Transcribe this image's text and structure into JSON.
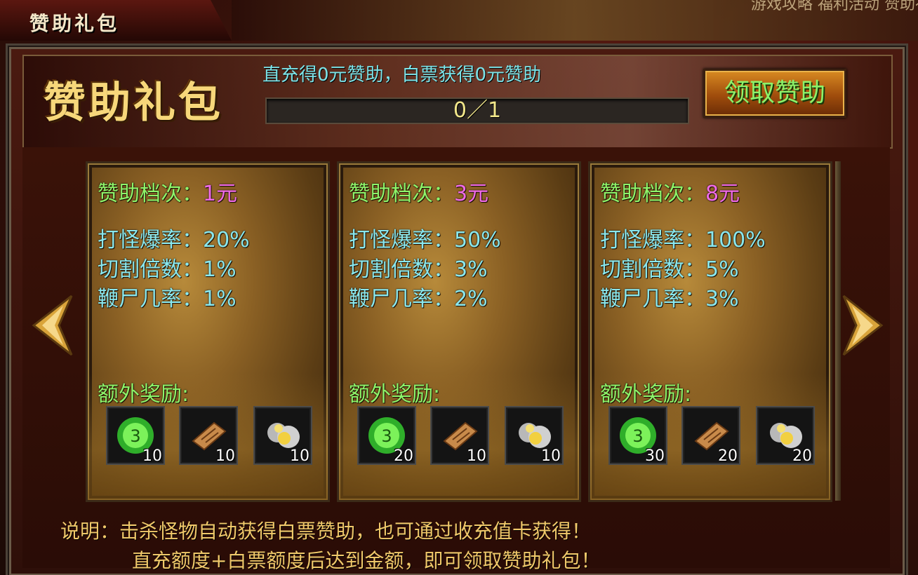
{
  "window": {
    "tab_title": "赞助礼包",
    "top_strip_text": "游戏攻略  福利活动  赞助礼包  全服活动  限时福利"
  },
  "header": {
    "big_title": "赞助礼包",
    "info_text": "直充得0元赞助，白票获得0元赞助",
    "progress_text": "0／1",
    "progress_fraction": 0,
    "claim_button": "领取赞助"
  },
  "cards": [
    {
      "tier_label": "赞助档次：",
      "tier_value": "1元",
      "drop_rate": "打怪爆率：20%",
      "cut_mult": "切割倍数：1%",
      "whip_rate": "鞭尸几率：1%",
      "extra_label": "额外奖励:",
      "items": [
        {
          "icon": "green-orb-icon",
          "count": "10"
        },
        {
          "icon": "scroll-icon",
          "count": "10"
        },
        {
          "icon": "gold-ore-icon",
          "count": "10"
        }
      ]
    },
    {
      "tier_label": "赞助档次：",
      "tier_value": "3元",
      "drop_rate": "打怪爆率：50%",
      "cut_mult": "切割倍数：3%",
      "whip_rate": "鞭尸几率：2%",
      "extra_label": "额外奖励:",
      "items": [
        {
          "icon": "green-orb-icon",
          "count": "20"
        },
        {
          "icon": "scroll-icon",
          "count": "10"
        },
        {
          "icon": "gold-ore-icon",
          "count": "10"
        }
      ]
    },
    {
      "tier_label": "赞助档次：",
      "tier_value": "8元",
      "drop_rate": "打怪爆率：100%",
      "cut_mult": "切割倍数：5%",
      "whip_rate": "鞭尸几率：3%",
      "extra_label": "额外奖励:",
      "items": [
        {
          "icon": "green-orb-icon",
          "count": "30"
        },
        {
          "icon": "scroll-icon",
          "count": "20"
        },
        {
          "icon": "gold-ore-icon",
          "count": "20"
        }
      ]
    }
  ],
  "description": {
    "line1": "说明：击杀怪物自动获得白票赞助，也可通过收充值卡获得！",
    "line2": "直充额度+白票额度后达到金额，即可领取赞助礼包！"
  },
  "colors": {
    "green_label": "#8ef56a",
    "pink_value": "#f06ae8",
    "cyan_text": "#8ae8ee",
    "gold_text": "#f0c86a"
  }
}
